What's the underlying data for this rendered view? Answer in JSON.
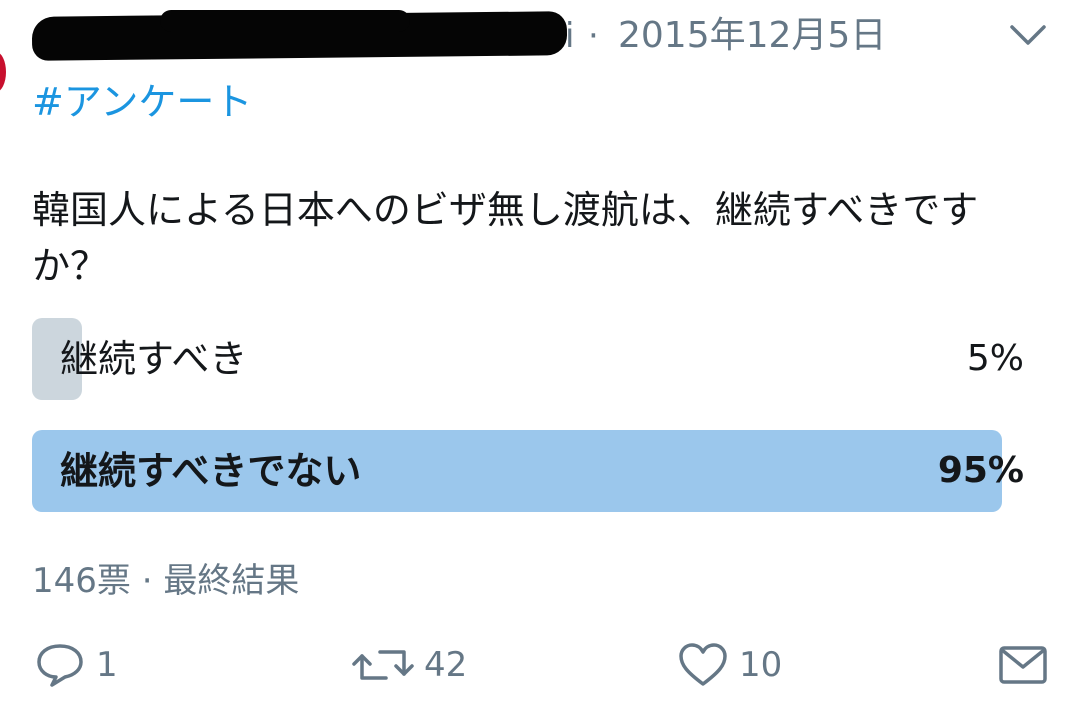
{
  "tweet": {
    "handle_tail": "i",
    "separator": "·",
    "date": "2015年12月5日",
    "hashtag": "#アンケート",
    "question": "韓国人による日本へのビザ無し渡航は、継続すべきですか？"
  },
  "poll": {
    "options": [
      {
        "label": "継続すべき",
        "percent_text": "5%",
        "percent": 5
      },
      {
        "label": "継続すべきでない",
        "percent_text": "95%",
        "percent": 95
      }
    ],
    "votes": "146票",
    "meta_sep": "·",
    "status": "最終結果"
  },
  "actions": {
    "reply_count": "1",
    "retweet_count": "42",
    "like_count": "10"
  },
  "colors": {
    "link": "#1b95e0",
    "muted": "#657786",
    "bar_loser": "#ccd6dd",
    "bar_winner": "#9bc7ec"
  },
  "icons": [
    "chevron-down-icon",
    "reply-icon",
    "retweet-icon",
    "like-icon",
    "message-icon"
  ]
}
